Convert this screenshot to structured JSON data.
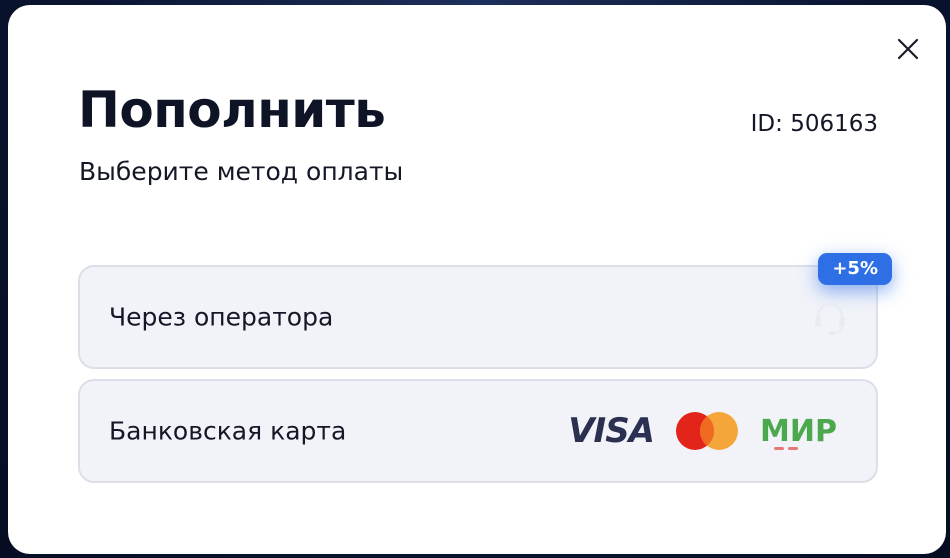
{
  "modal": {
    "title": "Пополнить",
    "subtitle": "Выберите метод оплаты",
    "user_id": "ID: 506163"
  },
  "methods": [
    {
      "label": "Через оператора",
      "badge": "+5%",
      "icon": "headset-icon"
    },
    {
      "label": "Банковская карта",
      "logos": {
        "visa": "VISA",
        "mastercard": "mastercard-logo",
        "mir": "МИР"
      }
    }
  ],
  "colors": {
    "accent": "#2f6fe6",
    "card_bg": "#f1f3f9",
    "card_border": "#dcdfe7",
    "text": "#141826",
    "title": "#0e1326",
    "mir_green": "#4ca84c",
    "mc_red": "#e3241b",
    "mc_orange": "#f5a02a"
  }
}
